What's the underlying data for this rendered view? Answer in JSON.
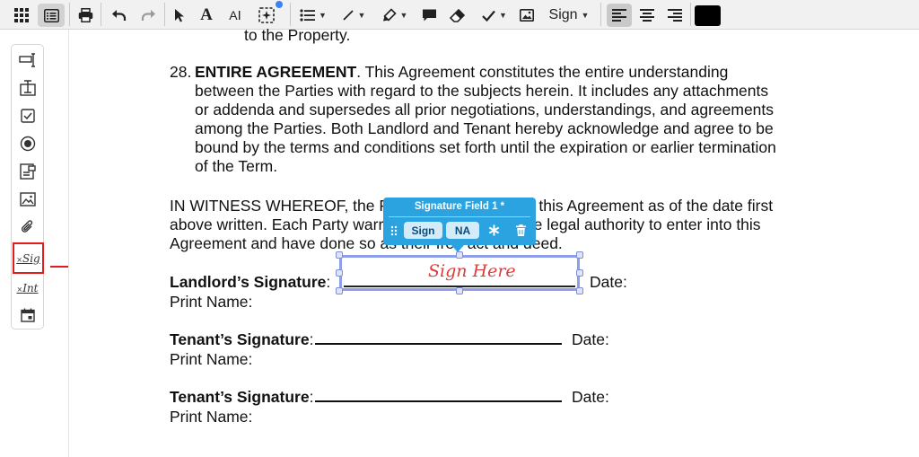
{
  "toolbar": {
    "sign_label": "Sign"
  },
  "document": {
    "prev_line": "to the Property.",
    "clause_number": "28.",
    "clause_title": "ENTIRE AGREEMENT",
    "clause_lines": [
      ". This Agreement constitutes the entire understanding",
      "between the Parties with regard to the subjects herein. It includes any attachments",
      "or addenda and supersedes all prior negotiations, understandings, and agreements",
      "among the Parties. Both Landlord and Tenant hereby acknowledge and agree to be",
      "bound by the terms and conditions set forth until the expiration or earlier termination",
      "of the Term."
    ],
    "witness_lines": [
      "IN WITNESS WHEREOF, the Parties have executed this Agreement as of the date first",
      "above written. Each Party warrants that they have the legal authority to enter into this",
      "Agreement and have done so as their free act and deed."
    ],
    "landlord_signature_label": "Landlord’s Signature",
    "tenant_signature_label": "Tenant’s Signature",
    "colon": ":",
    "date_label": "Date:",
    "print_name_label": "Print Name:"
  },
  "signature_popover": {
    "title": "Signature Field 1 *",
    "sign_button": "Sign",
    "na_button": "NA"
  },
  "signature_field": {
    "placeholder": "Sign Here"
  },
  "sidebar": {
    "signature_tool_label": "Sig",
    "initials_tool_label": "Int"
  },
  "colors": {
    "popover_bg": "#2aa3e0",
    "field_border": "#8f9ee8",
    "annotation_red": "#e11d1d",
    "current_color": "#000000"
  }
}
